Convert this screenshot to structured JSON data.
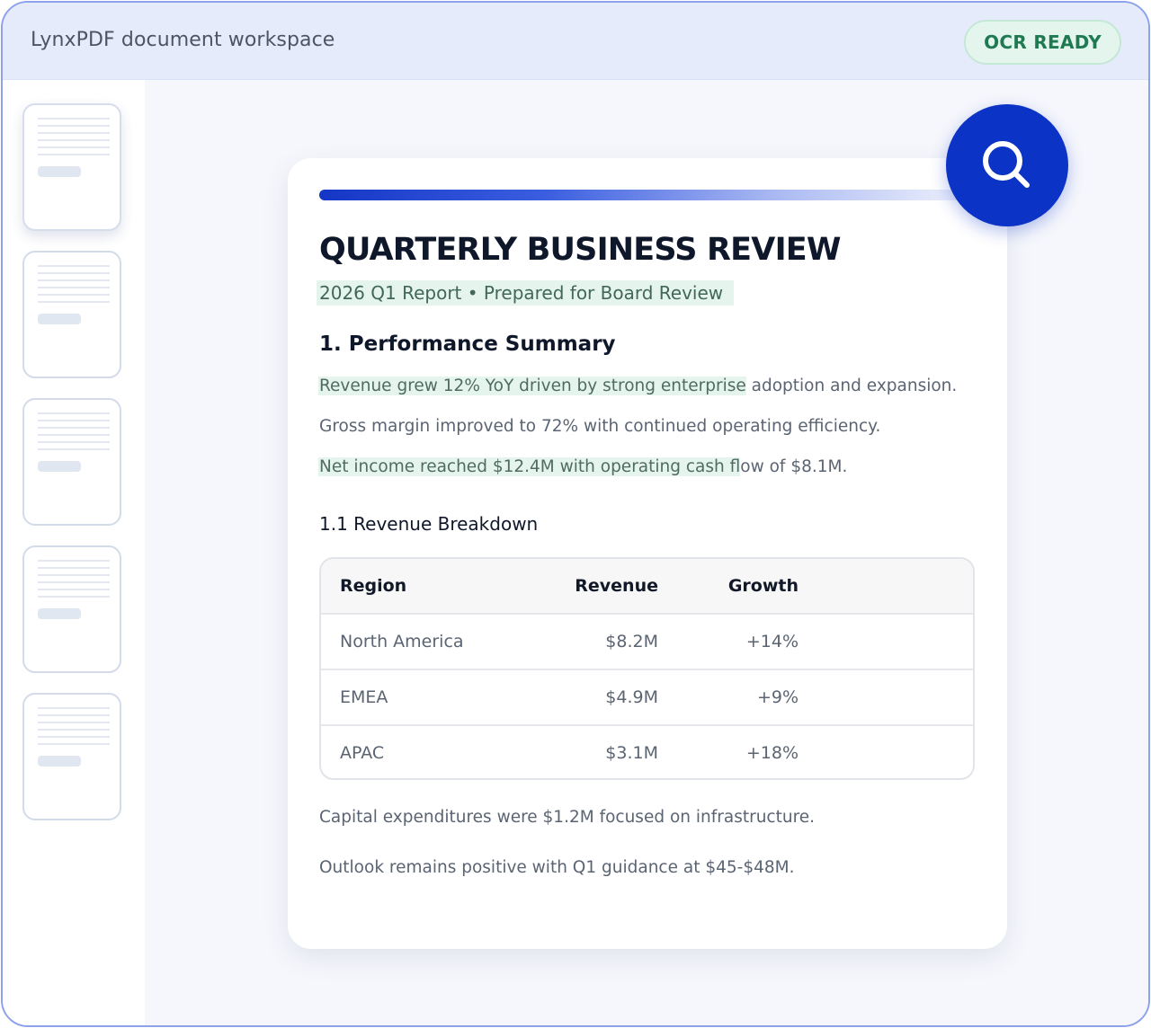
{
  "window": {
    "title": "LynxPDF document workspace",
    "status_badge": "OCR READY"
  },
  "sidebar": {
    "thumbnails": [
      {
        "page": 1,
        "active": true
      },
      {
        "page": 2,
        "active": false
      },
      {
        "page": 3,
        "active": false
      },
      {
        "page": 4,
        "active": false
      },
      {
        "page": 5,
        "active": false
      }
    ]
  },
  "document": {
    "title": "QUARTERLY BUSINESS REVIEW",
    "subtitle": "2026 Q1 Report • Prepared for Board Review",
    "section1": {
      "heading": "1. Performance Summary",
      "p1_highlighted": "Revenue grew 12% YoY driven by strong enterprise",
      "p1_rest": " adoption and expansion.",
      "p2": "Gross margin improved to 72% with continued operating efficiency.",
      "p3_highlighted": "Net income reached $12.4M with operating cash f",
      "p3_rest": "low of $8.1M."
    },
    "section1_1": {
      "heading": "1.1 Revenue Breakdown",
      "table": {
        "headers": [
          "Region",
          "Revenue",
          "Growth"
        ],
        "rows": [
          [
            "North America",
            "$8.2M",
            "+14%"
          ],
          [
            "EMEA",
            "$4.9M",
            "+9%"
          ],
          [
            "APAC",
            "$3.1M",
            "+18%"
          ]
        ]
      }
    },
    "closing": {
      "p1": "Capital expenditures were $1.2M focused on infrastructure.",
      "p2": "Outlook remains positive with Q1 guidance at $45-$48M."
    }
  },
  "actions": {
    "search_icon": "search-icon"
  },
  "colors": {
    "accent": "#0b33c6",
    "highlight": "#e5f5ed",
    "badge_text": "#1f7a52"
  }
}
